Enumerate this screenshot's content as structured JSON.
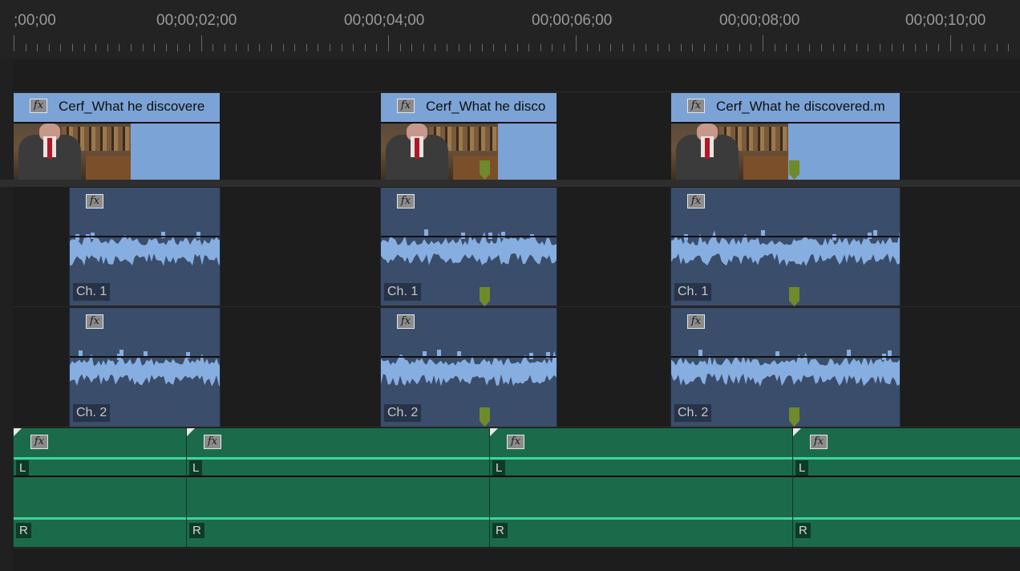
{
  "ruler": {
    "timecodes": [
      ";00;00",
      "00;00;02;00",
      "00;00;04;00",
      "00;00;06;00",
      "00;00;08;00",
      "00;00;10;00"
    ]
  },
  "video_clips": [
    {
      "title": "Cerf_What he discovere",
      "fx": "fx"
    },
    {
      "title": "Cerf_What he disco",
      "fx": "fx"
    },
    {
      "title": "Cerf_What he discovered.m",
      "fx": "fx"
    }
  ],
  "audio_track_1": {
    "label": "Ch. 1",
    "fx": "fx"
  },
  "audio_track_2": {
    "label": "Ch. 2",
    "fx": "fx"
  },
  "green_clips": {
    "fx": "fx",
    "left_label": "L",
    "right_label": "R"
  },
  "colors": {
    "video_clip": "#7ca3d6",
    "audio_clip": "#3a4d6b",
    "waveform": "#86aee0",
    "green_clip": "#1b6b4b",
    "green_line": "#3ed49a",
    "marker": "#6f8a2a"
  }
}
